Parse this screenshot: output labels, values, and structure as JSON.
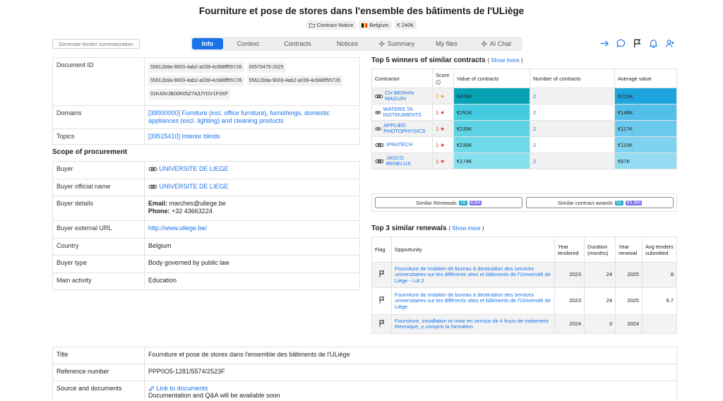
{
  "header": {
    "title": "Fourniture et pose de stores dans l'ensemble des bâtiments de l'ULiège",
    "badges": {
      "type": "Contract Notice",
      "country": "Belgium",
      "value": "€ 240K"
    }
  },
  "toolbar": {
    "generate_label": "Generate tender summarization",
    "tabs": [
      "Info",
      "Context",
      "Contracts",
      "Notices",
      "Summary",
      "My files",
      "AI Chat"
    ]
  },
  "details": {
    "document_id_label": "Document ID",
    "document_ids": [
      "55612b9a-9003-4ab2-a039-4c688ff55726",
      "00570475-2025",
      "55612b9a-9003-4ab2-a039-4c688ff55726",
      "55612b9a-9003-4ab2-a039-4c688ff55726",
      "01K43VJB00R05Z7A3JYOV1P3XF"
    ],
    "domains_label": "Domains",
    "domains_value": "[39000000] Furniture (incl. office furniture), furnishings, domestic appliances (excl. lighting) and cleaning products",
    "topics_label": "Topics",
    "topics_value": "[39515410] Interior blinds"
  },
  "scope": {
    "heading": "Scope of procurement",
    "buyer_label": "Buyer",
    "buyer_value": "UNIVERSITE DE LIEGE",
    "official_label": "Buyer official name",
    "official_value": "UNIVERSITE DE LIEGE",
    "details_label": "Buyer details",
    "email_label": "Email:",
    "email_value": "marches@uliege.be",
    "phone_label": "Phone:",
    "phone_value": "+32 43663224",
    "url_label": "Buyer external URL",
    "url_value": "http://www.uliege.be/",
    "country_label": "Country",
    "country_value": "Belgium",
    "type_label": "Buyer type",
    "type_value": "Body governed by public law",
    "activity_label": "Main activity",
    "activity_value": "Education"
  },
  "winners": {
    "heading": "Top 5 winners of similar contracts",
    "show_more": "Show more",
    "columns": [
      "Contractor",
      "Score",
      "Value of contracts",
      "Number of contracts",
      "Average value"
    ],
    "rows": [
      {
        "name": "CH BERHIN MAGUIN",
        "score": "2",
        "value": "€425K",
        "count": "2",
        "avg": "€213K"
      },
      {
        "name": "WATERS TA INSTRUMENTS",
        "score": "1",
        "value": "€291K",
        "count": "2",
        "avg": "€146K"
      },
      {
        "name": "APPLIED PHOTOPHYSICS",
        "score": "1",
        "value": "€235K",
        "count": "2",
        "avg": "€117K"
      },
      {
        "name": "IPRATECH",
        "score": "1",
        "value": "€230K",
        "count": "2",
        "avg": "€115K"
      },
      {
        "name": "JASCO BENELUX",
        "score": "1",
        "value": "€174K",
        "count": "2",
        "avg": "€87K"
      }
    ],
    "colors": {
      "value": [
        "#07a3b5",
        "#45cbe0",
        "#5ed3e4",
        "#6fdaea",
        "#86e0ee"
      ],
      "avg": [
        "#1ea4de",
        "#52bfe8",
        "#6ac9ec",
        "#7fd3f0",
        "#95dcf3"
      ]
    }
  },
  "similar": {
    "renewals_label": "Similar Renewals",
    "renewals_count": "16",
    "renewals_value": "€3M",
    "awards_label": "Similar contract awards",
    "awards_count": "51",
    "awards_value": "€5.9M"
  },
  "renewals": {
    "heading": "Top 3 similar renewals",
    "show_more": "Show more",
    "columns": [
      "Flag",
      "Opportunity",
      "Year tendered",
      "Duration (months)",
      "Year renewal",
      "Avg tenders submitted"
    ],
    "rows": [
      {
        "opportunity": "Fourniture de mobilier de bureau à destination des services universitaires sur les différents sites et bâtiments de l'Université de Liège - Lot 2",
        "year": "2023",
        "duration": "24",
        "renewal": "2025",
        "avg": "8"
      },
      {
        "opportunity": "Fourniture de mobilier de bureau à destination des services universitaires sur les différents sites et bâtiments de l'Université de Liège",
        "year": "2023",
        "duration": "24",
        "renewal": "2025",
        "avg": "6.7"
      },
      {
        "opportunity": "Fourniture, installation et mise en service de 4 fours de traitement thermique, y compris la formation",
        "year": "2024",
        "duration": "3",
        "renewal": "2024",
        "avg": ""
      }
    ]
  },
  "general": {
    "title_label": "Title",
    "title_value": "Fourniture et pose de stores dans l'ensemble des bâtiments de l'ULiège",
    "ref_label": "Reference number",
    "ref_value": "PPP0O5-1281/5574/2523F",
    "source_label": "Source and documents",
    "source_link": "Link to documents",
    "source_note": "Documentation and Q&A will be available soon"
  }
}
